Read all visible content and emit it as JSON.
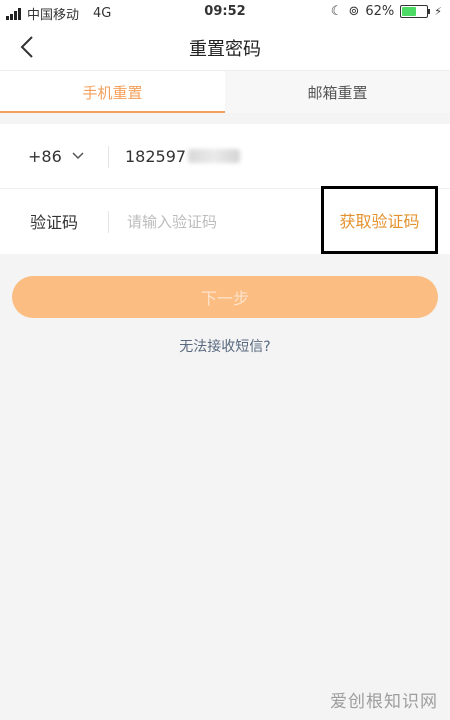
{
  "status_bar": {
    "carrier": "中国移动",
    "network": "4G",
    "time": "09:52",
    "battery": "62%",
    "battery_level": 0.62
  },
  "nav": {
    "title": "重置密码"
  },
  "tabs": {
    "phone": "手机重置",
    "email": "邮箱重置"
  },
  "form": {
    "country_code": "+86",
    "phone_value": "182597",
    "code_label": "验证码",
    "code_placeholder": "请输入验证码",
    "get_code_label": "获取验证码"
  },
  "actions": {
    "next_label": "下一步",
    "sms_link": "无法接收短信?"
  },
  "watermark": "爱创根知识网",
  "colors": {
    "accent": "#f5a05a",
    "get_code_text": "#e3922f",
    "next_button": "#fbbd82"
  }
}
